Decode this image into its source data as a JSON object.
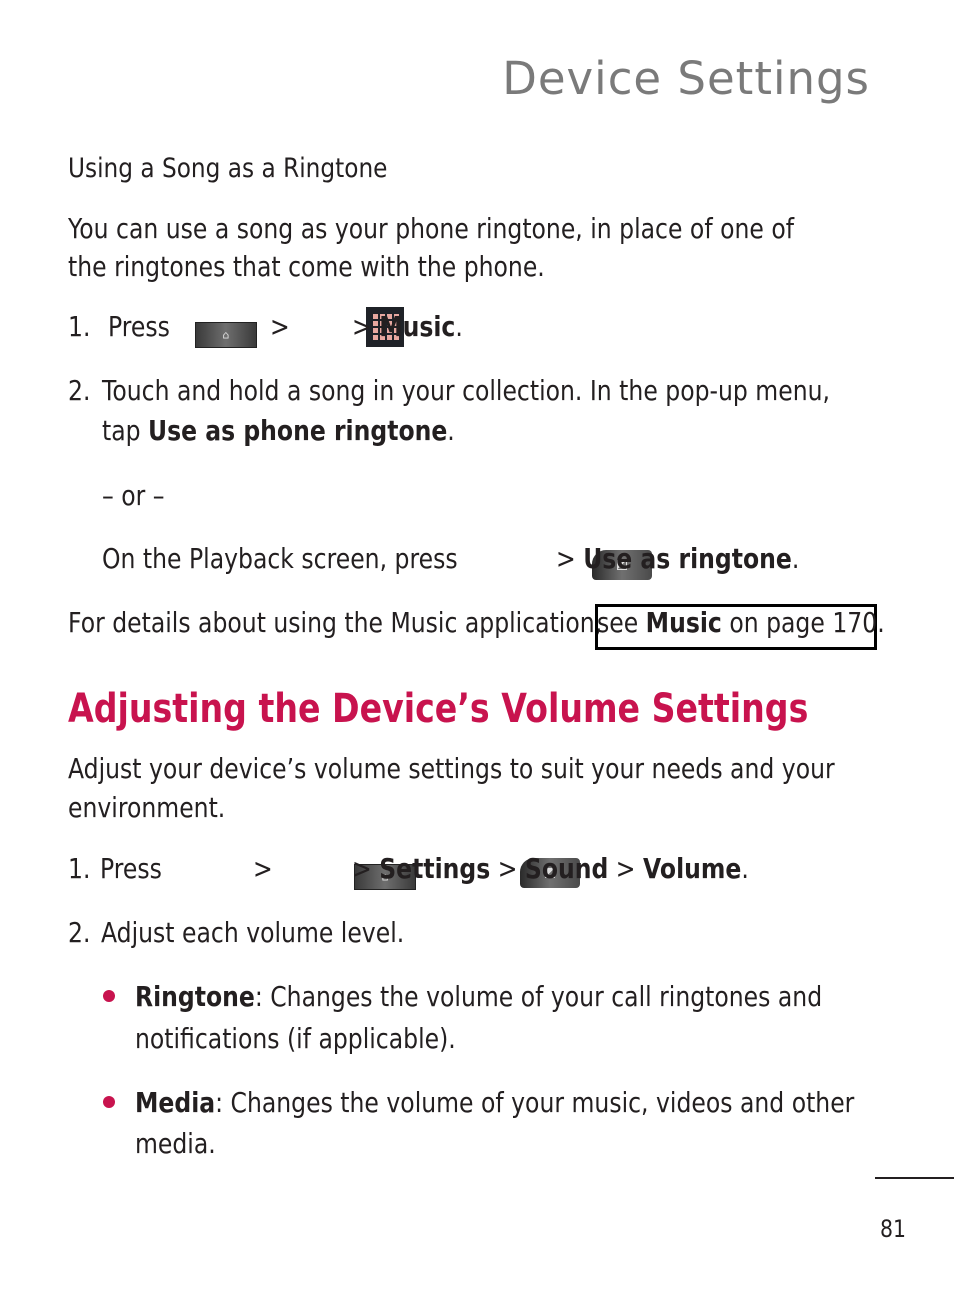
{
  "header": {
    "title": "Device Settings"
  },
  "section1": {
    "subheading": "Using a Song as a Ringtone",
    "intro_line1": "You can use a song as your phone ringtone, in place of one of",
    "intro_line2": "the ringtones that come with the phone.",
    "step1": {
      "number": "1.",
      "press": "Press",
      "sep1": ">",
      "sep2": ">",
      "target": "Music",
      "end": ".",
      "icons": [
        "home-key-icon",
        "applications-grid-icon"
      ]
    },
    "step2": {
      "number": "2.",
      "line1": "Touch and hold a song in your collection. In the pop-up menu,",
      "line2_pre": "tap ",
      "line2_bold": "Use as phone ringtone",
      "line2_end": "."
    },
    "or": "– or –",
    "playback": {
      "pre": "On the Playback screen, press",
      "sep": ">",
      "bold": "Use as ringtone",
      "end": ".",
      "icons": [
        "menu-key-icon"
      ]
    },
    "details": {
      "pre": "For details about using the Music application, ",
      "link_pre": "see ",
      "link_bold": "Music",
      "link_post": " on page 170."
    }
  },
  "section2": {
    "title": "Adjusting the Device’s Volume Settings",
    "intro_line1": "Adjust your device’s volume settings to suit your needs and your",
    "intro_line2": "environment.",
    "step1": {
      "number": "1.",
      "press": "Press",
      "sep1": ">",
      "sep2": ">",
      "item1": "Settings",
      "sep3": ">",
      "item2": "Sound",
      "sep4": ">",
      "item3": "Volume",
      "end": ".",
      "icons": [
        "home-key-icon",
        "menu-key-icon"
      ]
    },
    "step2": {
      "number": "2.",
      "text": "Adjust each volume level."
    },
    "bullets": [
      {
        "term": "Ringtone",
        "line1": ": Changes the volume of your call ringtones and",
        "line2": "notifications (if applicable)."
      },
      {
        "term": "Media",
        "line1": ": Changes the volume of your music, videos and other",
        "line2": "media."
      }
    ]
  },
  "footer": {
    "page_number": "81"
  },
  "colors": {
    "accent": "#c8134e",
    "header_gray": "#7a7a7a",
    "text": "#231f20"
  }
}
